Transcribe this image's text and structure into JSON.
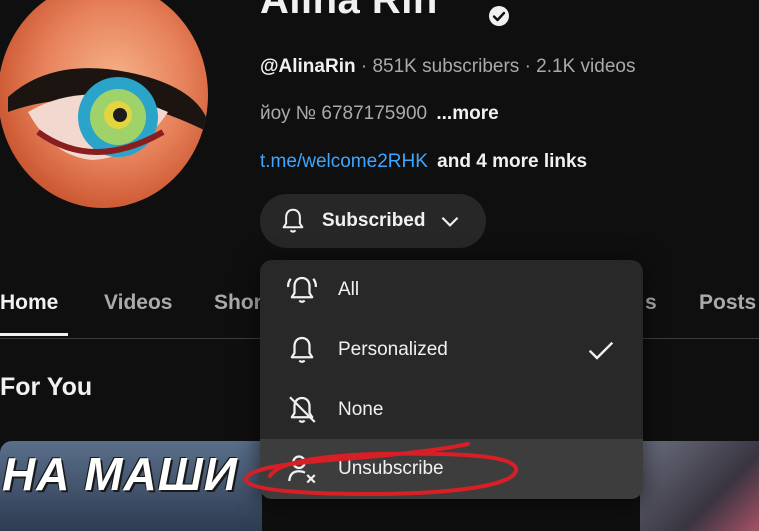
{
  "channel": {
    "name": "Alina Rin",
    "handle": "@AlinaRin",
    "subscribers": "· 851K subscribers",
    "videos": "· 2.1K videos",
    "description": "йоу № 6787175900",
    "more_label": "...more",
    "link": "t.me/welcome2RHK",
    "more_links": "and 4 more links"
  },
  "subscribe_button": {
    "label": "Subscribed",
    "icon": "bell-icon"
  },
  "tabs": [
    {
      "label": "Home",
      "active": true
    },
    {
      "label": "Videos"
    },
    {
      "label": "Shor"
    },
    {
      "label": "s"
    },
    {
      "label": "Posts"
    }
  ],
  "section_title": "For You",
  "thumbnail": {
    "text": "НА МАШИ"
  },
  "notification_menu": {
    "items": [
      {
        "label": "All",
        "icon": "bell-ringing-icon"
      },
      {
        "label": "Personalized",
        "icon": "bell-icon",
        "checked": true
      },
      {
        "label": "None",
        "icon": "bell-off-icon"
      },
      {
        "label": "Unsubscribe",
        "icon": "person-remove-icon"
      }
    ]
  },
  "colors": {
    "background": "#0f0f0f",
    "menu_background": "#282828",
    "link": "#3ea6ff",
    "annotation": "#d81f26"
  }
}
